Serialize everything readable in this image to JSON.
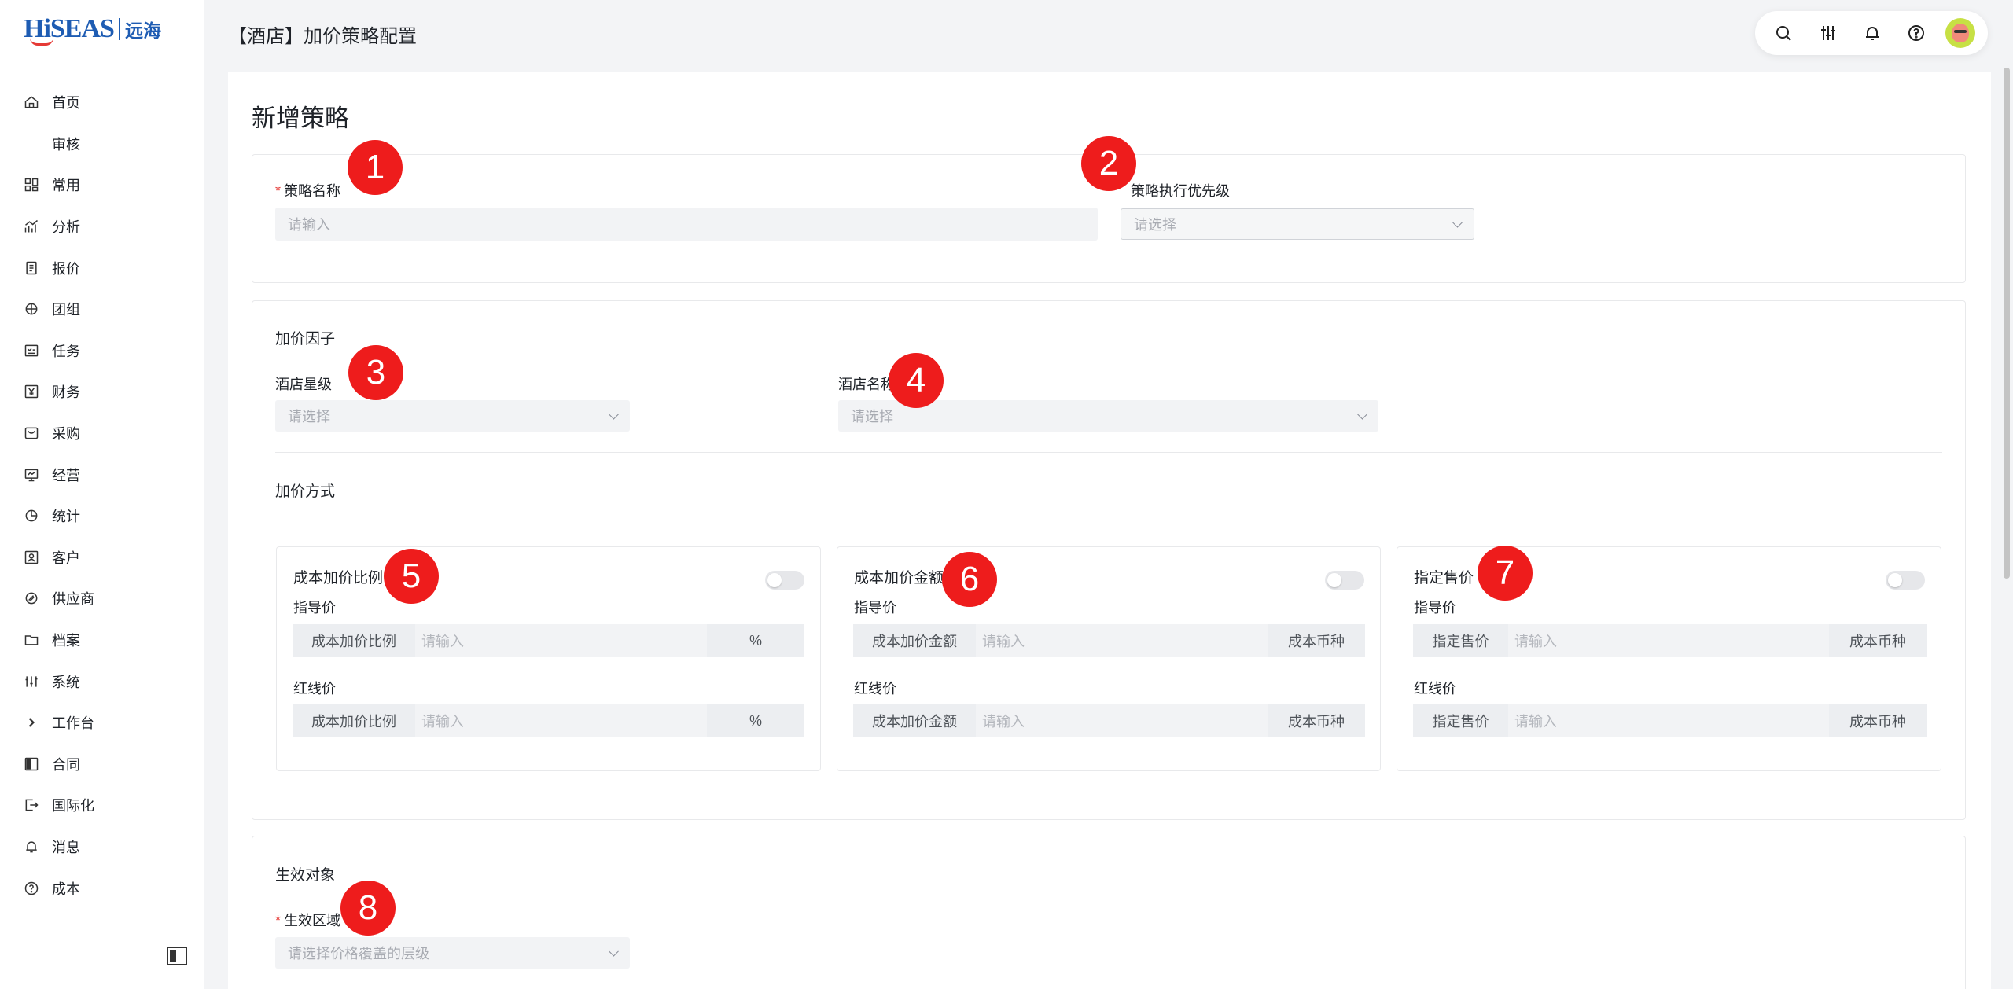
{
  "logo": {
    "brand": "HiSEAS",
    "cn": "远海"
  },
  "sidebar": {
    "items": [
      {
        "icon": "home-icon",
        "label": "首页"
      },
      {
        "icon": "",
        "label": "审核"
      },
      {
        "icon": "grid-icon",
        "label": "常用"
      },
      {
        "icon": "analytics-icon",
        "label": "分析"
      },
      {
        "icon": "document-icon",
        "label": "报价"
      },
      {
        "icon": "group-icon",
        "label": "团组"
      },
      {
        "icon": "task-icon",
        "label": "任务"
      },
      {
        "icon": "yen-icon",
        "label": "财务"
      },
      {
        "icon": "cart-icon",
        "label": "采购"
      },
      {
        "icon": "monitor-icon",
        "label": "经营"
      },
      {
        "icon": "pie-icon",
        "label": "统计"
      },
      {
        "icon": "customer-icon",
        "label": "客户"
      },
      {
        "icon": "supplier-icon",
        "label": "供应商"
      },
      {
        "icon": "folder-icon",
        "label": "档案"
      },
      {
        "icon": "sliders-icon",
        "label": "系统"
      },
      {
        "icon": "chevron-right-icon",
        "label": "工作台"
      },
      {
        "icon": "contract-icon",
        "label": "合同"
      },
      {
        "icon": "logout-icon",
        "label": "国际化"
      },
      {
        "icon": "bell-icon",
        "label": "消息"
      },
      {
        "icon": "help-icon",
        "label": "成本"
      }
    ]
  },
  "header": {
    "title": "【酒店】加价策略配置"
  },
  "toolbar": {
    "icons": [
      "search-icon",
      "sliders-icon",
      "bell-icon",
      "help-icon",
      "avatar"
    ]
  },
  "page": {
    "title": "新增策略"
  },
  "basic": {
    "name_label": "策略名称",
    "name_required": "*",
    "name_placeholder": "请输入",
    "priority_label": "策略执行优先级",
    "priority_placeholder": "请选择"
  },
  "factors": {
    "title": "加价因子",
    "star_label": "酒店星级",
    "star_placeholder": "请选择",
    "hotel_label": "酒店名称",
    "hotel_placeholder": "请选择"
  },
  "method": {
    "title": "加价方式",
    "cards": [
      {
        "title": "成本加价比例",
        "enabled": false,
        "guide_label": "指导价",
        "guide_prefix": "成本加价比例",
        "guide_placeholder": "请输入",
        "guide_suffix": "%",
        "red_label": "红线价",
        "red_prefix": "成本加价比例",
        "red_placeholder": "请输入",
        "red_suffix": "%"
      },
      {
        "title": "成本加价金额",
        "enabled": false,
        "guide_label": "指导价",
        "guide_prefix": "成本加价金额",
        "guide_placeholder": "请输入",
        "guide_suffix": "成本币种",
        "red_label": "红线价",
        "red_prefix": "成本加价金额",
        "red_placeholder": "请输入",
        "red_suffix": "成本币种"
      },
      {
        "title": "指定售价",
        "enabled": false,
        "guide_label": "指导价",
        "guide_prefix": "指定售价",
        "guide_placeholder": "请输入",
        "guide_suffix": "成本币种",
        "red_label": "红线价",
        "red_prefix": "指定售价",
        "red_placeholder": "请输入",
        "red_suffix": "成本币种"
      }
    ]
  },
  "target": {
    "title": "生效对象",
    "region_label": "生效区域",
    "region_required": "*",
    "region_placeholder": "请选择价格覆盖的层级"
  },
  "annotations": [
    "1",
    "2",
    "3",
    "4",
    "5",
    "6",
    "7",
    "8"
  ],
  "colors": {
    "badge": "#ee1c1c",
    "brand": "#1e5cb3",
    "required": "#e53935"
  }
}
